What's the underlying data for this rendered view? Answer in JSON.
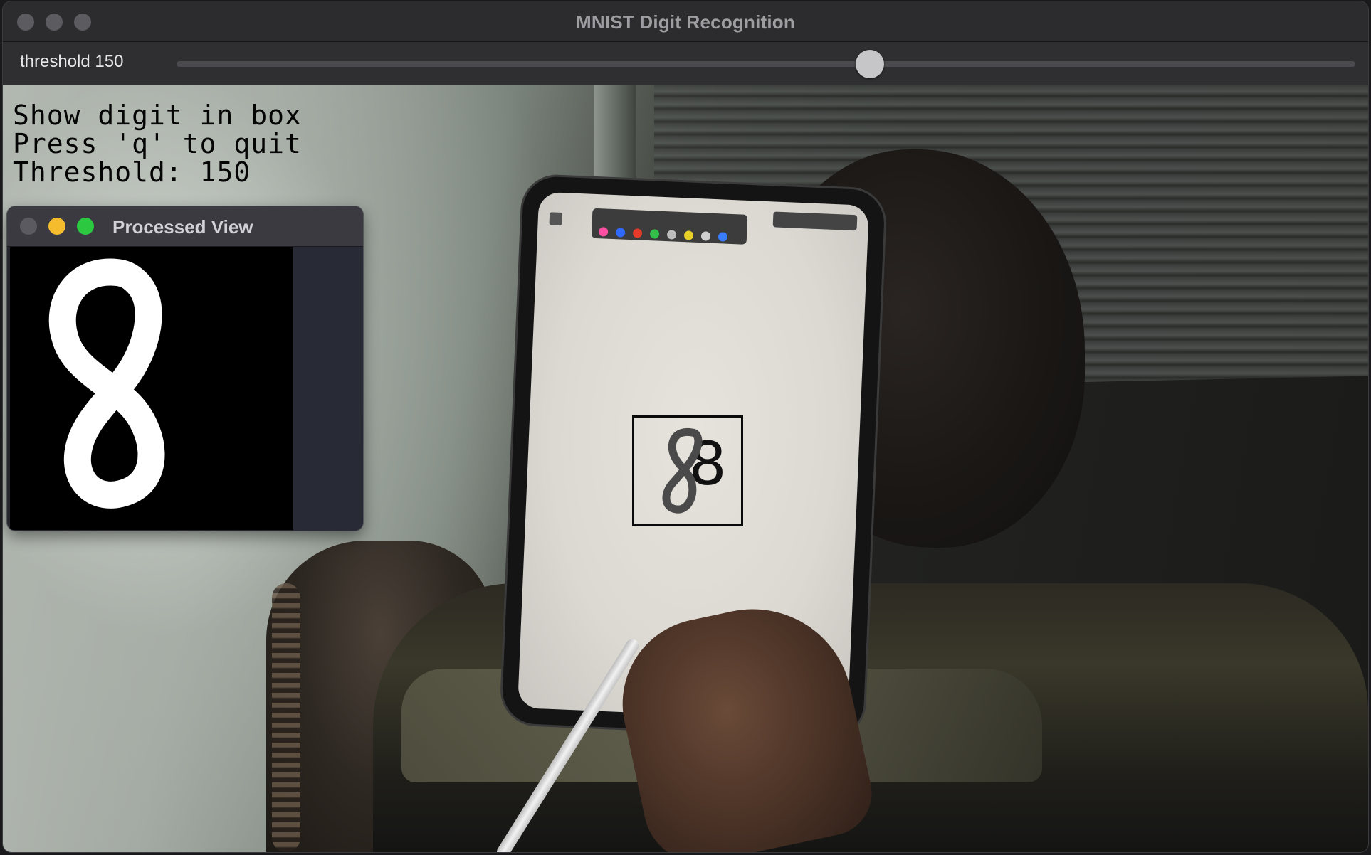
{
  "window": {
    "title": "MNIST Digit Recognition",
    "traffic_lights": [
      "close-button",
      "minimize-button",
      "zoom-button"
    ]
  },
  "trackbar": {
    "label": "threshold 150",
    "value": 150,
    "min": 0,
    "max": 255,
    "thumb_color": "#c6c6c8"
  },
  "overlay": {
    "lines": [
      "Show digit in box",
      "Press 'q' to quit",
      "Threshold: 150"
    ]
  },
  "prediction": {
    "digit": "8"
  },
  "processed_window": {
    "title": "Processed View",
    "traffic_colors": [
      "#5a5a60",
      "#f5bc2e",
      "#2bc840"
    ]
  },
  "tablet_palette": [
    "#ff4fa3",
    "#2f6bff",
    "#e83a2a",
    "#2fbf4a",
    "#bdbdbd",
    "#e8d12a",
    "#d0d0d0",
    "#3a7bff"
  ],
  "icons": {
    "close": "close-icon",
    "minimize": "minimize-icon",
    "zoom": "zoom-icon"
  }
}
